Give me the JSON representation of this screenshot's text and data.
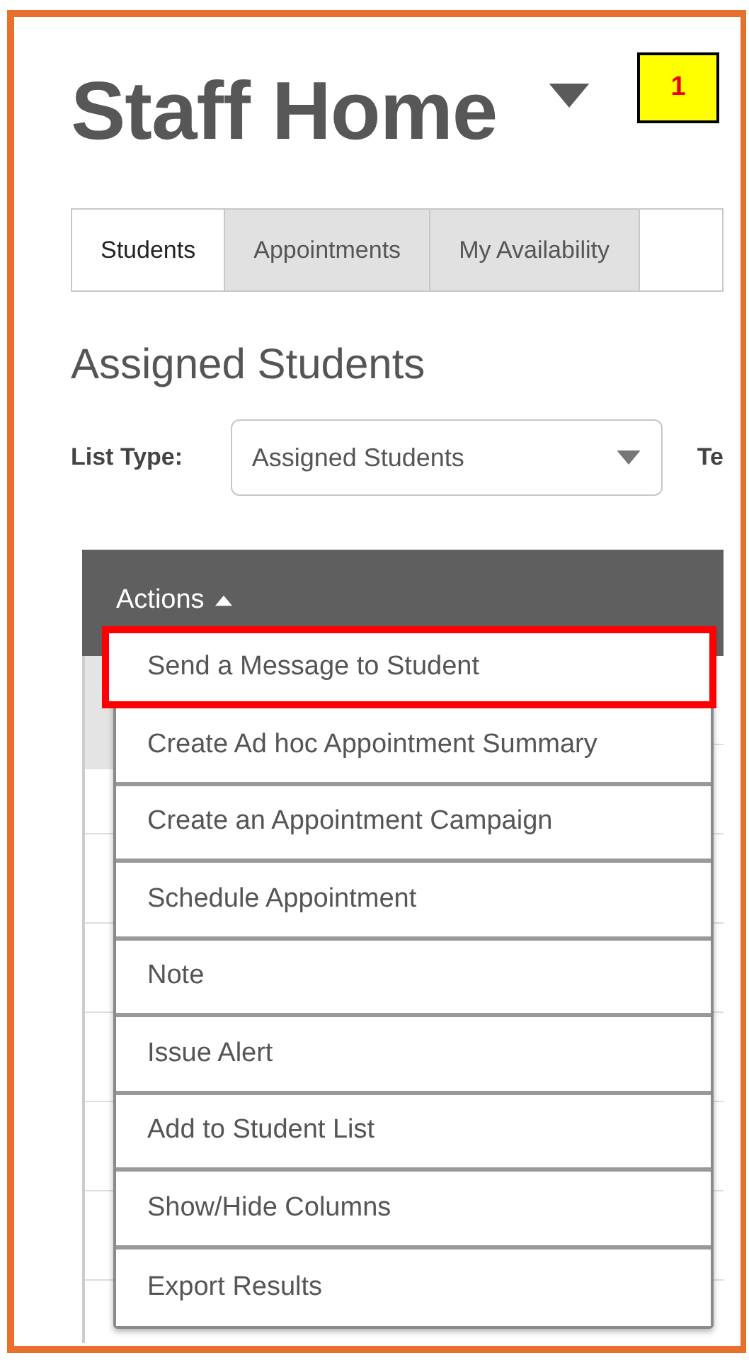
{
  "page_title": "Staff Home",
  "callout": {
    "number": "1"
  },
  "tabs": [
    {
      "label": "Students",
      "selected": true
    },
    {
      "label": "Appointments",
      "selected": false
    },
    {
      "label": "My Availability",
      "selected": false
    }
  ],
  "section_title": "Assigned Students",
  "filters": [
    {
      "label": "List Type:",
      "value": "Assigned Students"
    }
  ],
  "cut_label": "Te",
  "table": {
    "actions_label": "Actions",
    "actions_expanded": true
  },
  "actions_menu": [
    {
      "label": "Send a Message to Student",
      "highlighted": true
    },
    {
      "label": "Create Ad hoc Appointment Summary",
      "highlighted": false
    },
    {
      "label": "Create an Appointment Campaign",
      "highlighted": false
    },
    {
      "label": "Schedule Appointment",
      "highlighted": false
    },
    {
      "label": "Note",
      "highlighted": false
    },
    {
      "label": "Issue Alert",
      "highlighted": false
    },
    {
      "label": "Add to Student List",
      "highlighted": false
    },
    {
      "label": "Show/Hide Columns",
      "highlighted": false
    },
    {
      "label": "Export Results",
      "highlighted": false
    }
  ]
}
